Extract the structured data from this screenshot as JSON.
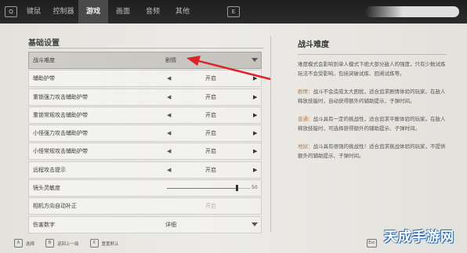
{
  "topbar": {
    "left_key": "Q",
    "right_key": "E",
    "tabs": [
      {
        "label": "键鼠",
        "active": false
      },
      {
        "label": "控制器",
        "active": false
      },
      {
        "label": "游戏",
        "active": true
      },
      {
        "label": "画面",
        "active": false
      },
      {
        "label": "音频",
        "active": false
      },
      {
        "label": "其他",
        "active": false
      }
    ]
  },
  "settings": {
    "section_title": "基础设置",
    "rows": [
      {
        "label": "战斗难度",
        "value": "剧情"
      },
      {
        "label": "辅助护带",
        "value": "开启"
      },
      {
        "label": "重锁强力攻击辅助护带",
        "value": "开启"
      },
      {
        "label": "重锁常规攻击辅助护带",
        "value": "开启"
      },
      {
        "label": "小怪强力攻击辅助护带",
        "value": "开启"
      },
      {
        "label": "小怪常规攻击辅助护带",
        "value": "开启"
      },
      {
        "label": "远程攻击提示",
        "value": "开启"
      },
      {
        "label": "镜头灵敏度",
        "value": "50",
        "level": 0.85
      },
      {
        "label": "相机方向自动补正",
        "value": "开启"
      },
      {
        "label": "伤害数字",
        "value": "详细"
      }
    ]
  },
  "info": {
    "title": "战斗难度",
    "intro": "难度模式会影响到单人模式下绝大部分敌人的强度，只有少数试炼玩法不会受影响，包括突破试炼、回溯试炼等。",
    "story_kw": "剧情：",
    "story_text": "战斗不会造成太大困扰，适合追求剧情体验的玩家。在敌人释放技能时，自动获得额外的辅助提示，子弹时间。",
    "normal_kw": "普通：",
    "normal_text": "战斗具有一定的挑战性，适合追求平衡体验的玩家。在敌人释放技能时，可选择获得额外的辅助提示、子弹时间。",
    "hard_kw": "地狱：",
    "hard_text": "战斗具有很强的挑战性！适合追求挑战体验的玩家，不提供额外的辅助提示、子弹时间。"
  },
  "hints": [
    {
      "key": "A",
      "label": "选择"
    },
    {
      "key": "B",
      "label": "返回上一级"
    },
    {
      "key": "X",
      "label": "重置默认"
    }
  ],
  "esc_key": "Esc",
  "watermark": "天成手游网",
  "colors": {
    "accent": "#d9252a",
    "keyword": "#b97a3c",
    "topbar": "#262626"
  }
}
